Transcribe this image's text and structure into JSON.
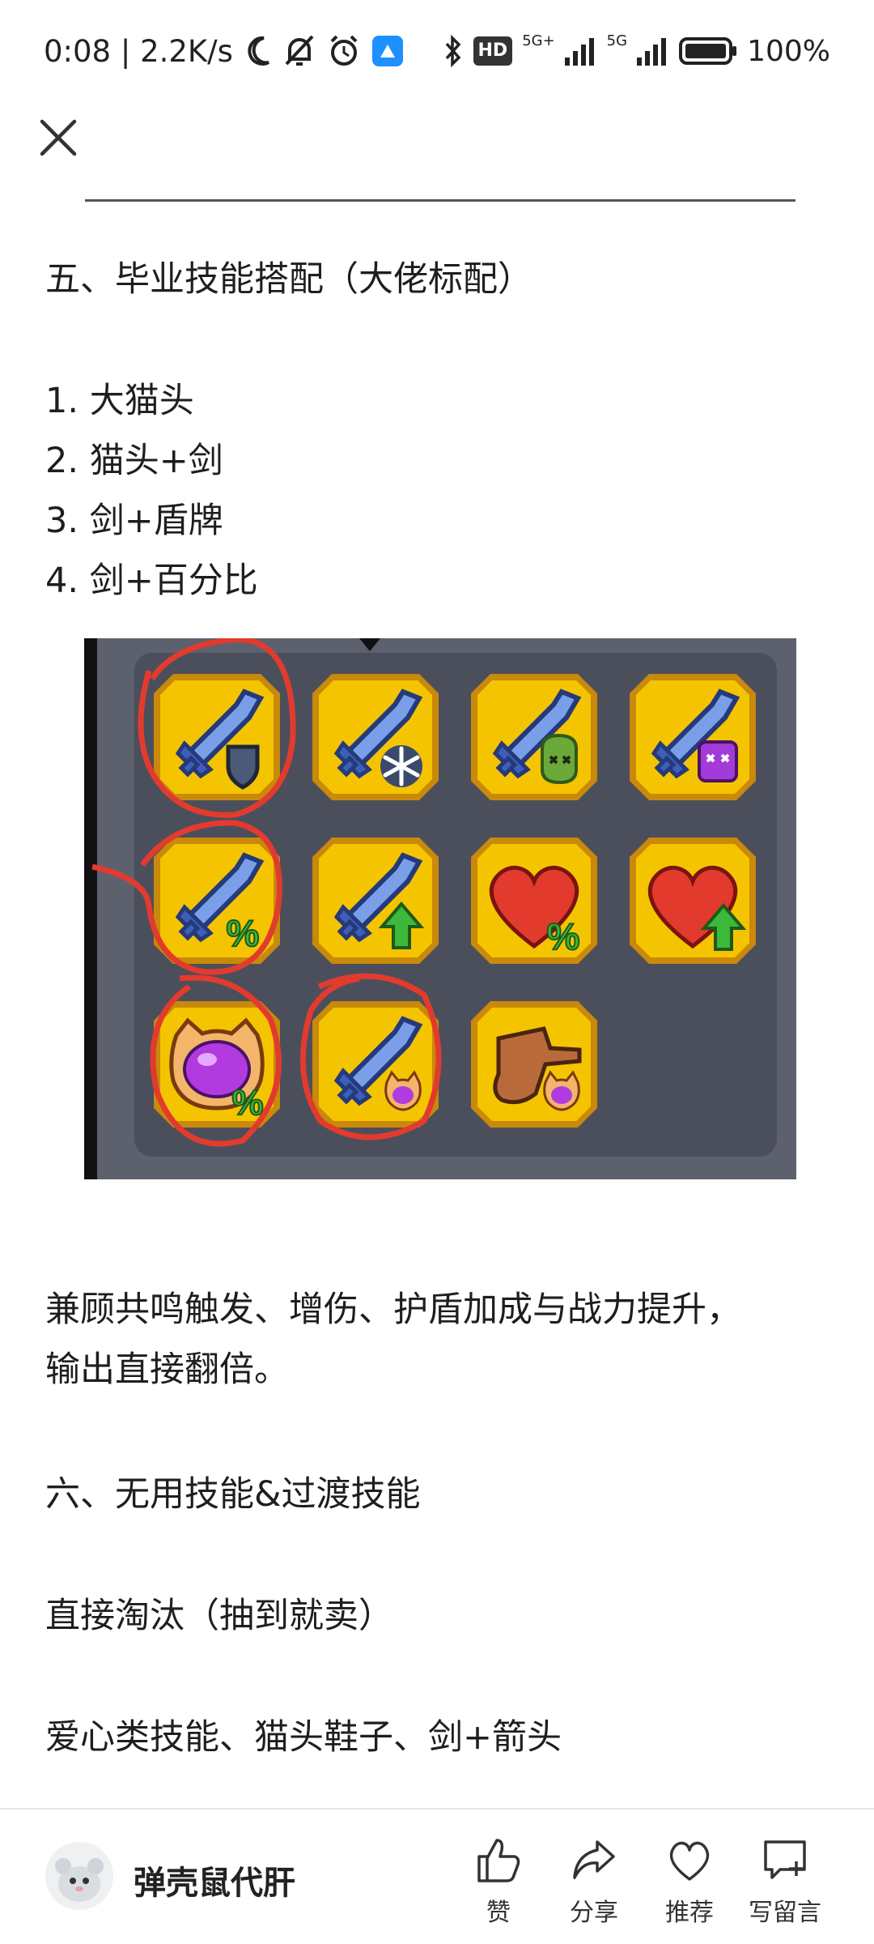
{
  "status_bar": {
    "time_speed": "0:08 | 2.2K/s",
    "hd_label": "HD",
    "net1": "5G+",
    "net2": "5G",
    "battery": "100%"
  },
  "article": {
    "section5_title": "五、毕业技能搭配（大佬标配）",
    "combos": [
      "1. 大猫头",
      "2. 猫头+剑",
      "3. 剑+盾牌",
      "4. 剑+百分比"
    ],
    "summary_line1": "兼顾共鸣触发、增伤、护盾加成与战力提升，",
    "summary_line2": "输出直接翻倍。",
    "section6_title": "六、无用技能&过渡技能",
    "eliminate": "直接淘汰（抽到就卖）",
    "useless_list": "爱心类技能、猫头鞋子、剑+箭头"
  },
  "game_image": {
    "tiles": [
      {
        "icon": "sword-shield-icon",
        "badge": "shield"
      },
      {
        "icon": "sword-snowflake-icon",
        "badge": "snowflake"
      },
      {
        "icon": "sword-green-skull-icon",
        "badge": "green-skull"
      },
      {
        "icon": "sword-purple-skull-icon",
        "badge": "purple-skull"
      },
      {
        "icon": "sword-percent-icon",
        "badge": "%"
      },
      {
        "icon": "sword-arrow-icon",
        "badge": "arrow"
      },
      {
        "icon": "heart-percent-icon",
        "badge": "%"
      },
      {
        "icon": "heart-arrow-icon",
        "badge": "arrow"
      },
      {
        "icon": "cat-head-percent-icon",
        "badge": "%"
      },
      {
        "icon": "sword-cat-icon",
        "badge": "cat"
      },
      {
        "icon": "boot-cat-icon",
        "badge": "cat"
      }
    ],
    "percent": "%",
    "circled_tiles": [
      "sword-shield-icon",
      "sword-percent-icon",
      "cat-head-percent-icon",
      "sword-cat-icon"
    ]
  },
  "bottom_bar": {
    "author": "弹壳鼠代肝",
    "like": "赞",
    "share": "分享",
    "recommend": "推荐",
    "comment": "写留言"
  },
  "colors": {
    "tile_gold": "#f5c400",
    "tile_border": "#c9890a",
    "circle_red": "#e23b2e",
    "sword_blue": "#7a9fe8"
  }
}
